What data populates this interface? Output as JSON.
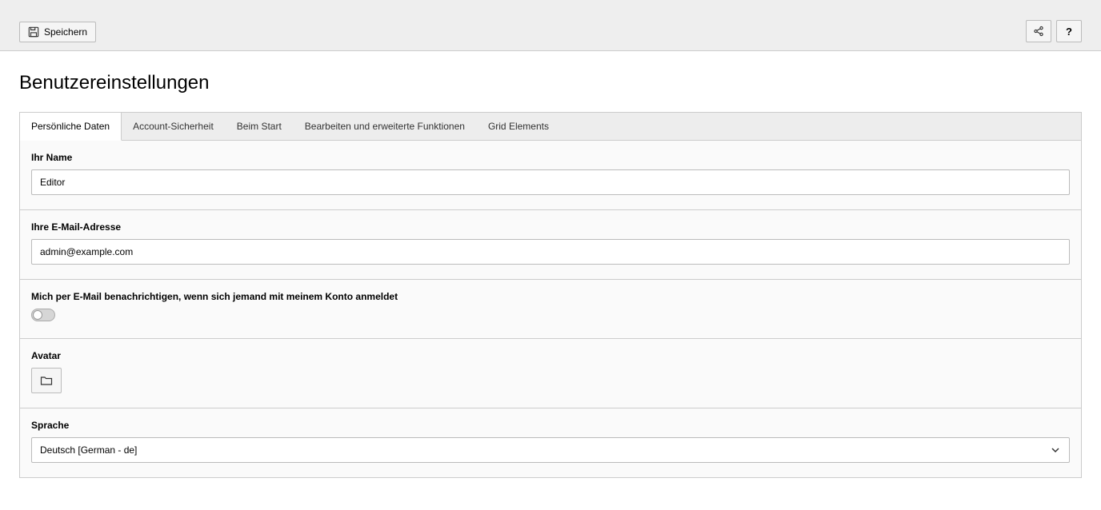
{
  "toolbar": {
    "save_label": "Speichern"
  },
  "page": {
    "title": "Benutzereinstellungen"
  },
  "tabs": [
    {
      "label": "Persönliche Daten",
      "active": true
    },
    {
      "label": "Account-Sicherheit",
      "active": false
    },
    {
      "label": "Beim Start",
      "active": false
    },
    {
      "label": "Bearbeiten und erweiterte Funktionen",
      "active": false
    },
    {
      "label": "Grid Elements",
      "active": false
    }
  ],
  "form": {
    "name": {
      "label": "Ihr Name",
      "value": "Editor"
    },
    "email": {
      "label": "Ihre E-Mail-Adresse",
      "value": "admin@example.com"
    },
    "notify": {
      "label": "Mich per E-Mail benachrichtigen, wenn sich jemand mit meinem Konto anmeldet",
      "value": false
    },
    "avatar": {
      "label": "Avatar"
    },
    "language": {
      "label": "Sprache",
      "value": "Deutsch [German - de]"
    }
  }
}
